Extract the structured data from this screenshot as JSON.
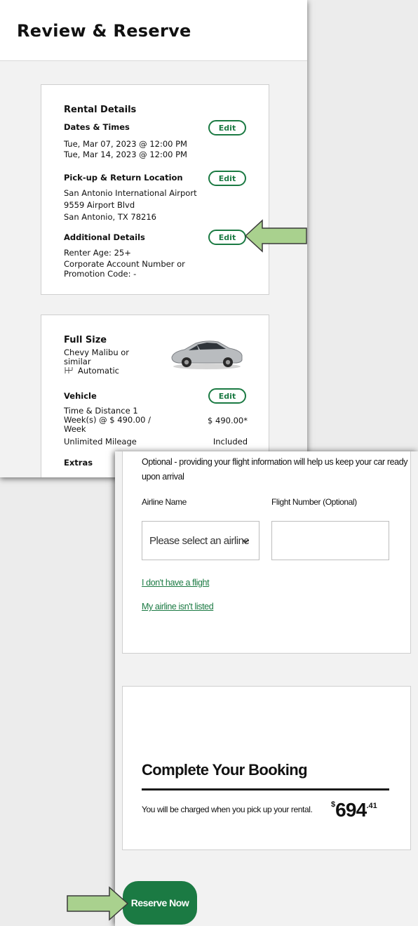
{
  "review": {
    "page_title": "Review & Reserve",
    "rental_details": {
      "heading": "Rental Details",
      "dates_heading": "Dates & Times",
      "pickup_datetime": "Tue, Mar 07, 2023 @ 12:00 PM",
      "return_datetime": "Tue, Mar 14, 2023 @ 12:00 PM",
      "location_heading": "Pick-up & Return Location",
      "location_name": "San Antonio International Airport",
      "address_line": "9559 Airport Blvd",
      "city_line": "San Antonio, TX 78216",
      "additional_heading": "Additional Details",
      "renter_age": "Renter Age: 25+",
      "promo_line1": "Corporate Account Number or",
      "promo_line2": "Promotion Code: -",
      "edit_label": "Edit"
    },
    "vehicle_card": {
      "class_name": "Full Size",
      "model_line1": "Chevy Malibu or",
      "model_line2": "similar",
      "transmission": "Automatic",
      "vehicle_heading": "Vehicle",
      "rate_line1": "Time & Distance 1",
      "rate_line2": "Week(s) @ $ 490.00 /",
      "rate_line3": "Week",
      "rate_amount": "$ 490.00*",
      "mileage_label": "Unlimited Mileage",
      "mileage_value": "Included",
      "extras_heading": "Extras",
      "edit_label": "Edit"
    }
  },
  "flight": {
    "note": "Optional - providing your flight information will help us keep your car ready upon arrival",
    "airline_label": "Airline Name",
    "airline_placeholder": "Please select an airline",
    "flight_number_label": "Flight Number (Optional)",
    "no_flight_link": "I don't have a flight",
    "not_listed_link": "My airline isn't listed"
  },
  "booking": {
    "title": "Complete Your Booking",
    "charge_note": "You will be charged when you pick up your rental.",
    "total_currency": "$",
    "total_main": "694",
    "total_cents": ".41",
    "reserve_label": "Reserve Now"
  },
  "colors": {
    "accent_green": "#1b7a43",
    "arrow_fill": "#a9d18e"
  },
  "icons": [
    "transmission-icon",
    "chevron-down-icon",
    "car-image",
    "callout-arrow"
  ]
}
